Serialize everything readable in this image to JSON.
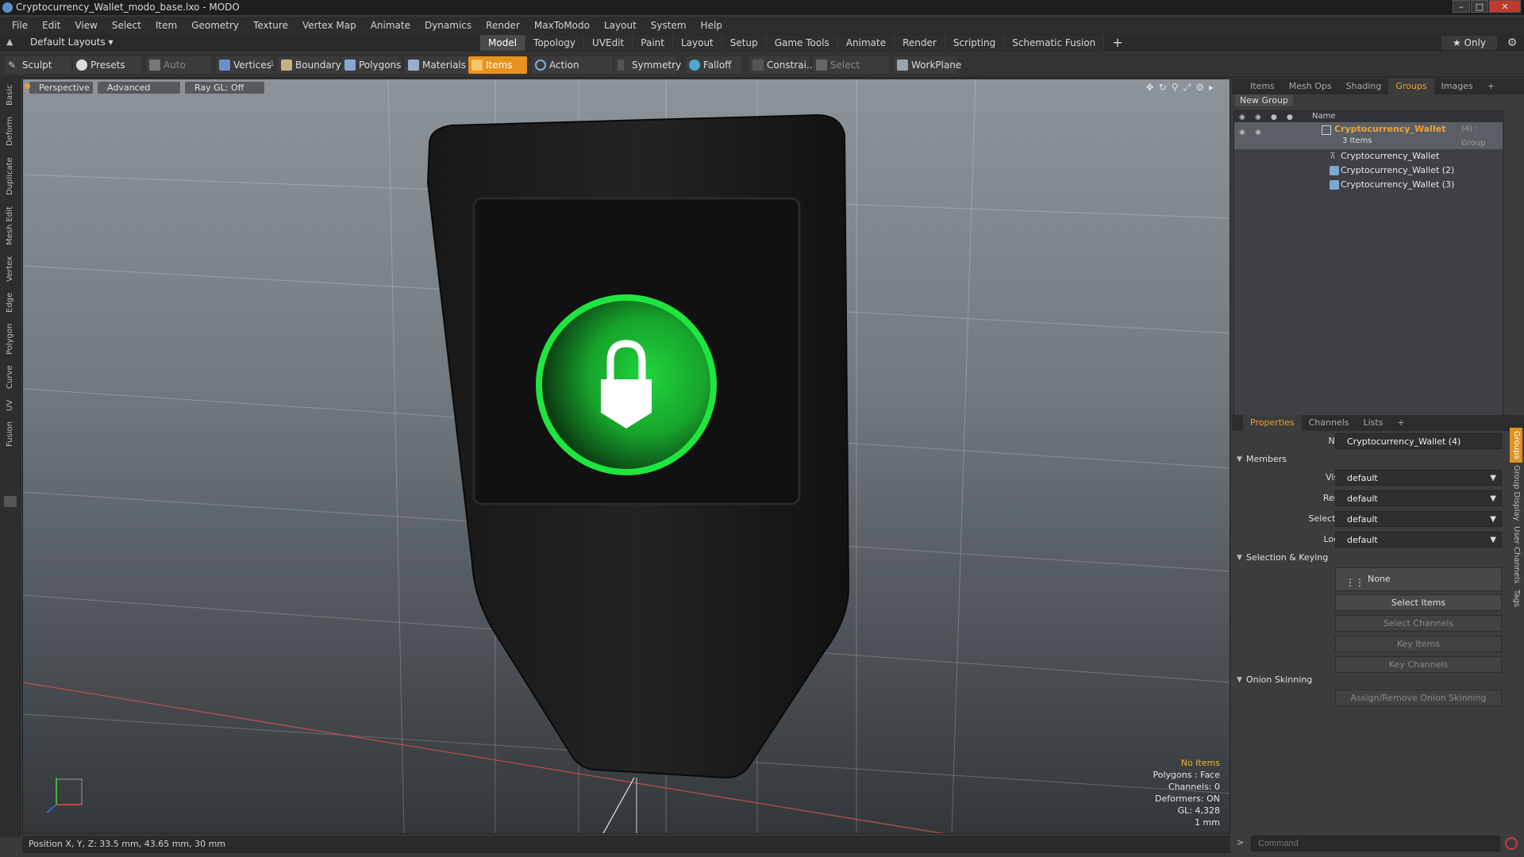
{
  "window": {
    "title": "Cryptocurrency_Wallet_modo_base.lxo - MODO"
  },
  "menubar": [
    "File",
    "Edit",
    "View",
    "Select",
    "Item",
    "Geometry",
    "Texture",
    "Vertex Map",
    "Animate",
    "Dynamics",
    "Render",
    "MaxToModo",
    "Layout",
    "System",
    "Help"
  ],
  "layout": {
    "dropdown": "Default Layouts ▾",
    "tabs": [
      "Model",
      "Topology",
      "UVEdit",
      "Paint",
      "Layout",
      "Setup",
      "Game Tools",
      "Animate",
      "Render",
      "Scripting",
      "Schematic Fusion"
    ],
    "active_tab": "Model",
    "plus": "+",
    "only": "★  Only"
  },
  "toolbar": {
    "sculpt": "Sculpt",
    "presets": "Presets",
    "auto_select": "Auto Select",
    "vertices": "Vertices",
    "vertices_count": "1",
    "boundary": "Boundary",
    "polygons": "Polygons",
    "materials": "Materials",
    "items": "Items",
    "action_center": "Action Center",
    "symmetry": "Symmetry",
    "falloff": "Falloff",
    "constrain": "Constrai...",
    "select_through": "Select Through",
    "workplane": "WorkPlane"
  },
  "left_tabs": [
    "Basic",
    "Deform",
    "Duplicate",
    "Mesh Edit",
    "Vertex",
    "Edge",
    "Polygon",
    "Curve",
    "UV",
    "Fusion"
  ],
  "viewport": {
    "perspective": "Perspective",
    "advanced": "Advanced",
    "raygl": "Ray GL: Off",
    "info": {
      "items": "No Items",
      "polygons": "Polygons : Face",
      "channels": "Channels: 0",
      "deformers": "Deformers: ON",
      "gl": "GL: 4,328",
      "scale": "1 mm"
    }
  },
  "status": {
    "position": "Position X, Y, Z:  33.5 mm, 43.65 mm, 30 mm"
  },
  "right_panel": {
    "top_tabs": [
      "Items",
      "Mesh Ops",
      "Shading",
      "Groups",
      "Images",
      "+"
    ],
    "active_top": "Groups",
    "new_group": "New Group",
    "name_col": "Name",
    "group": {
      "name": "Cryptocurrency_Wallet",
      "suffix": "(4) : Group",
      "count": "3 Items",
      "children": [
        "Cryptocurrency_Wallet",
        "Cryptocurrency_Wallet (2)",
        "Cryptocurrency_Wallet (3)"
      ]
    },
    "prop_tabs": [
      "Properties",
      "Channels",
      "Lists",
      "+"
    ],
    "active_prop": "Properties",
    "props": {
      "name_label": "Name",
      "name_value": "Cryptocurrency_Wallet (4)",
      "members": "Members",
      "visible_label": "Visible",
      "render_label": "Render",
      "selectable_label": "Selectable",
      "locked_label": "Locked",
      "default": "default",
      "selection_keying": "Selection & Keying",
      "none": "None",
      "select_items": "Select Items",
      "select_channels": "Select Channels",
      "key_items": "Key Items",
      "key_channels": "Key Channels",
      "onion": "Onion Skinning",
      "assign_onion": "Assign/Remove Onion Skinning"
    },
    "side_tabs": [
      "Groups",
      "Group Display",
      "User Channels",
      "Tags"
    ],
    "command_placeholder": "Command"
  },
  "colors": {
    "accent": "#e8921e",
    "lock_green": "#19d63a",
    "group_highlight": "#f0a030"
  }
}
